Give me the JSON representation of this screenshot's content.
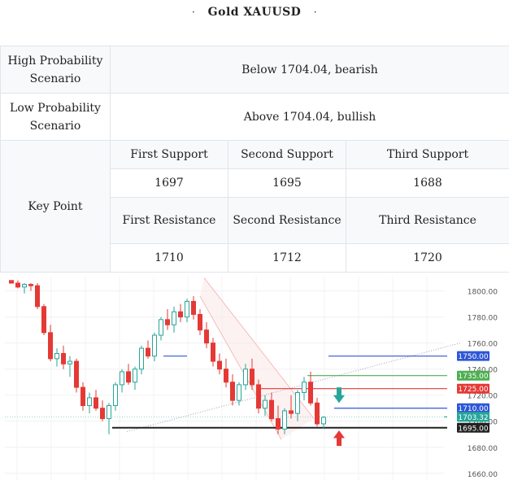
{
  "title": {
    "text": "Gold XAUUSD",
    "left_mark": "·",
    "right_mark": "·"
  },
  "rows": {
    "high": {
      "label": "High Probability Scenario",
      "value": "Below 1704.04, bearish"
    },
    "low": {
      "label": "Low Probability Scenario",
      "value": "Above 1704.04, bullish"
    },
    "key": {
      "label": "Key Point",
      "support_labels": [
        "First Support",
        "Second Support",
        "Third Support"
      ],
      "support_values": [
        "1697",
        "1695",
        "1688"
      ],
      "resistance_labels": [
        "First Resistance",
        "Second Resistance",
        "Third Resistance"
      ],
      "resistance_values": [
        "1710",
        "1712",
        "1720"
      ]
    }
  },
  "chart_data": {
    "type": "candlestick",
    "y_ticks": [
      1800,
      1780,
      1760,
      1740,
      1720,
      1700,
      1680,
      1660
    ],
    "ylim": [
      1658,
      1806
    ],
    "candles": [
      [
        1808,
        1808,
        1806,
        1806
      ],
      [
        1806,
        1808,
        1802,
        1803
      ],
      [
        1803,
        1806,
        1798,
        1805
      ],
      [
        1805,
        1806,
        1800,
        1804
      ],
      [
        1804,
        1806,
        1786,
        1788
      ],
      [
        1788,
        1790,
        1766,
        1768
      ],
      [
        1768,
        1774,
        1746,
        1748
      ],
      [
        1748,
        1756,
        1742,
        1752
      ],
      [
        1752,
        1758,
        1740,
        1744
      ],
      [
        1744,
        1750,
        1734,
        1746
      ],
      [
        1746,
        1748,
        1722,
        1726
      ],
      [
        1726,
        1730,
        1708,
        1712
      ],
      [
        1712,
        1722,
        1706,
        1718
      ],
      [
        1718,
        1724,
        1708,
        1710
      ],
      [
        1710,
        1716,
        1700,
        1702
      ],
      [
        1702,
        1714,
        1690,
        1712
      ],
      [
        1712,
        1730,
        1708,
        1728
      ],
      [
        1728,
        1740,
        1722,
        1738
      ],
      [
        1738,
        1744,
        1728,
        1730
      ],
      [
        1730,
        1742,
        1724,
        1740
      ],
      [
        1740,
        1758,
        1736,
        1756
      ],
      [
        1756,
        1762,
        1748,
        1750
      ],
      [
        1750,
        1768,
        1746,
        1766
      ],
      [
        1766,
        1780,
        1762,
        1778
      ],
      [
        1778,
        1786,
        1770,
        1774
      ],
      [
        1774,
        1788,
        1768,
        1784
      ],
      [
        1784,
        1790,
        1776,
        1780
      ],
      [
        1780,
        1794,
        1776,
        1792
      ],
      [
        1792,
        1796,
        1778,
        1782
      ],
      [
        1782,
        1786,
        1766,
        1770
      ],
      [
        1770,
        1776,
        1756,
        1760
      ],
      [
        1760,
        1764,
        1742,
        1746
      ],
      [
        1746,
        1752,
        1736,
        1740
      ],
      [
        1740,
        1748,
        1726,
        1730
      ],
      [
        1730,
        1736,
        1712,
        1716
      ],
      [
        1716,
        1730,
        1712,
        1728
      ],
      [
        1728,
        1744,
        1724,
        1740
      ],
      [
        1740,
        1748,
        1724,
        1728
      ],
      [
        1728,
        1732,
        1706,
        1710
      ],
      [
        1710,
        1720,
        1704,
        1716
      ],
      [
        1716,
        1722,
        1700,
        1702
      ],
      [
        1702,
        1712,
        1690,
        1694
      ],
      [
        1694,
        1710,
        1690,
        1708
      ],
      [
        1708,
        1720,
        1702,
        1706
      ],
      [
        1706,
        1724,
        1700,
        1722
      ],
      [
        1722,
        1734,
        1716,
        1730
      ],
      [
        1730,
        1738,
        1712,
        1714
      ],
      [
        1714,
        1718,
        1696,
        1698
      ],
      [
        1698,
        1704,
        1694,
        1703
      ]
    ],
    "levels": [
      {
        "price": 1750,
        "label": "1750.00",
        "color": "#2f56d6"
      },
      {
        "price": 1735,
        "label": "1735.00",
        "color": "#4caf50"
      },
      {
        "price": 1725,
        "label": "1725.00",
        "color": "#e53935"
      },
      {
        "price": 1710,
        "label": "1710.00",
        "color": "#2f56d6"
      },
      {
        "price": 1703.32,
        "label": "1703.32",
        "color": "#26a69a"
      },
      {
        "price": 1695,
        "label": "1695.00",
        "color": "#222222"
      }
    ],
    "up_color": "#26a69a",
    "down_color": "#e53935"
  }
}
